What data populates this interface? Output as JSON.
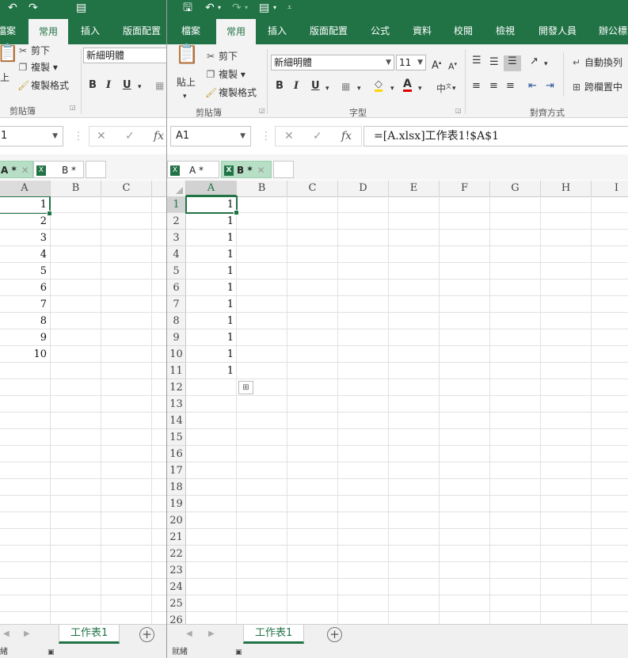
{
  "left": {
    "menu_tabs": [
      "檔案",
      "常用",
      "插入",
      "版面配置"
    ],
    "active_tab": "常用",
    "clipboard": {
      "cut": "剪下",
      "copy": "複製",
      "format_painter": "複製格式",
      "paste_partial": "上",
      "group": "剪貼簿"
    },
    "font_name": "新細明體",
    "name_box": "1",
    "doc_tabs": [
      {
        "label": "A *",
        "active": true
      },
      {
        "label": "B *",
        "active": false
      }
    ],
    "columns": [
      "A",
      "B",
      "C"
    ],
    "values": [
      "1",
      "2",
      "3",
      "4",
      "5",
      "6",
      "7",
      "8",
      "9",
      "10"
    ],
    "sheet_tab": "工作表1",
    "status": "緒"
  },
  "right": {
    "menu_tabs": [
      "檔案",
      "常用",
      "插入",
      "版面配置",
      "公式",
      "資料",
      "校閱",
      "檢視",
      "開發人員",
      "辦公標"
    ],
    "active_tab": "常用",
    "clipboard": {
      "cut": "剪下",
      "copy": "複製",
      "format_painter": "複製格式",
      "paste": "貼上",
      "group": "剪貼簿"
    },
    "font": {
      "name": "新細明體",
      "size": "11",
      "group": "字型",
      "bold": "B",
      "italic": "I",
      "underline": "U"
    },
    "alignment": {
      "wrap": "自動換列",
      "merge": "跨欄置中",
      "group": "對齊方式"
    },
    "name_box": "A1",
    "formula": "=[A.xlsx]工作表1!$A$1",
    "doc_tabs": [
      {
        "label": "A *",
        "active": false
      },
      {
        "label": "B *",
        "active": true
      }
    ],
    "columns": [
      "A",
      "B",
      "C",
      "D",
      "E",
      "F",
      "G",
      "H",
      "I"
    ],
    "rows": [
      "1",
      "2",
      "3",
      "4",
      "5",
      "6",
      "7",
      "8",
      "9",
      "10",
      "11",
      "12",
      "13",
      "14",
      "15",
      "16",
      "17",
      "18",
      "19",
      "20",
      "21",
      "22",
      "23",
      "24",
      "25",
      "26"
    ],
    "values": [
      "1",
      "1",
      "1",
      "1",
      "1",
      "1",
      "1",
      "1",
      "1",
      "1",
      "1"
    ],
    "sheet_tab": "工作表1",
    "status": "就緒"
  },
  "colors": {
    "excel_green": "#217346",
    "ribbon_bg": "#f3f3f3",
    "active_doc_tab": "#b7dfc6"
  }
}
